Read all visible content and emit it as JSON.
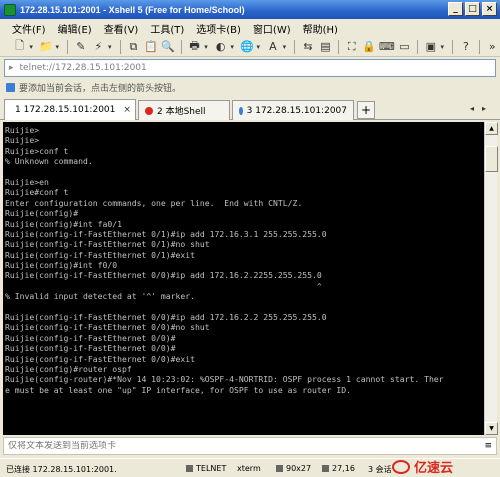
{
  "window": {
    "title": "172.28.15.101:2001 - Xshell 5 (Free for Home/School)"
  },
  "menu": [
    "文件(F)",
    "编辑(E)",
    "查看(V)",
    "工具(T)",
    "选项卡(B)",
    "窗口(W)",
    "帮助(H)"
  ],
  "address": {
    "value": "telnet://172.28.15.101:2001"
  },
  "hint": {
    "text": "要添加当前会话，点击左侧的箭头按钮。"
  },
  "tabs": [
    {
      "label": "1 172.28.15.101:2001",
      "color": "#2db84b",
      "active": true
    },
    {
      "label": "2 本地Shell",
      "color": "#d9271e",
      "active": false
    },
    {
      "label": "3 172.28.15.101:2007",
      "color": "#3a7fd5",
      "active": false
    }
  ],
  "terminal": {
    "lines": [
      "Ruijie>",
      "Ruijie>",
      "Ruijie>conf t",
      "% Unknown command.",
      "",
      "Ruijie>en",
      "Ruijie#conf t",
      "Enter configuration commands, one per line.  End with CNTL/Z.",
      "Ruijie(config)#",
      "Ruijie(config)#int fa0/1",
      "Ruijie(config-if-FastEthernet 0/1)#ip add 172.16.3.1 255.255.255.0",
      "Ruijie(config-if-FastEthernet 0/1)#no shut",
      "Ruijie(config-if-FastEthernet 0/1)#exit",
      "Ruijie(config)#int f0/0",
      "Ruijie(config-if-FastEthernet 0/0)#ip add 172.16.2.2255.255.255.0",
      "                                                                ^",
      "% Invalid input detected at '^' marker.",
      "",
      "Ruijie(config-if-FastEthernet 0/0)#ip add 172.16.2.2 255.255.255.0",
      "Ruijie(config-if-FastEthernet 0/0)#no shut",
      "Ruijie(config-if-FastEthernet 0/0)#",
      "Ruijie(config-if-FastEthernet 0/0)#",
      "Ruijie(config-if-FastEthernet 0/0)#exit",
      "Ruijie(config)#router ospf",
      "Ruijie(config-router)#*Nov 14 10:23:02: %OSPF-4-NORTRID: OSPF process 1 cannot start. Ther",
      "e must be at least one \"up\" IP interface, for OSPF to use as router ID.",
      "",
      "",
      "",
      ""
    ]
  },
  "input_bar": {
    "placeholder": "仅将文本发送到当前选项卡"
  },
  "status": {
    "connection": "已连接 172.28.15.101:2001.",
    "protocol": "TELNET",
    "term": "xterm",
    "size": "90x27",
    "cursor": "27,16",
    "sessions": "3 会话"
  },
  "watermark": {
    "text": "亿速云"
  }
}
